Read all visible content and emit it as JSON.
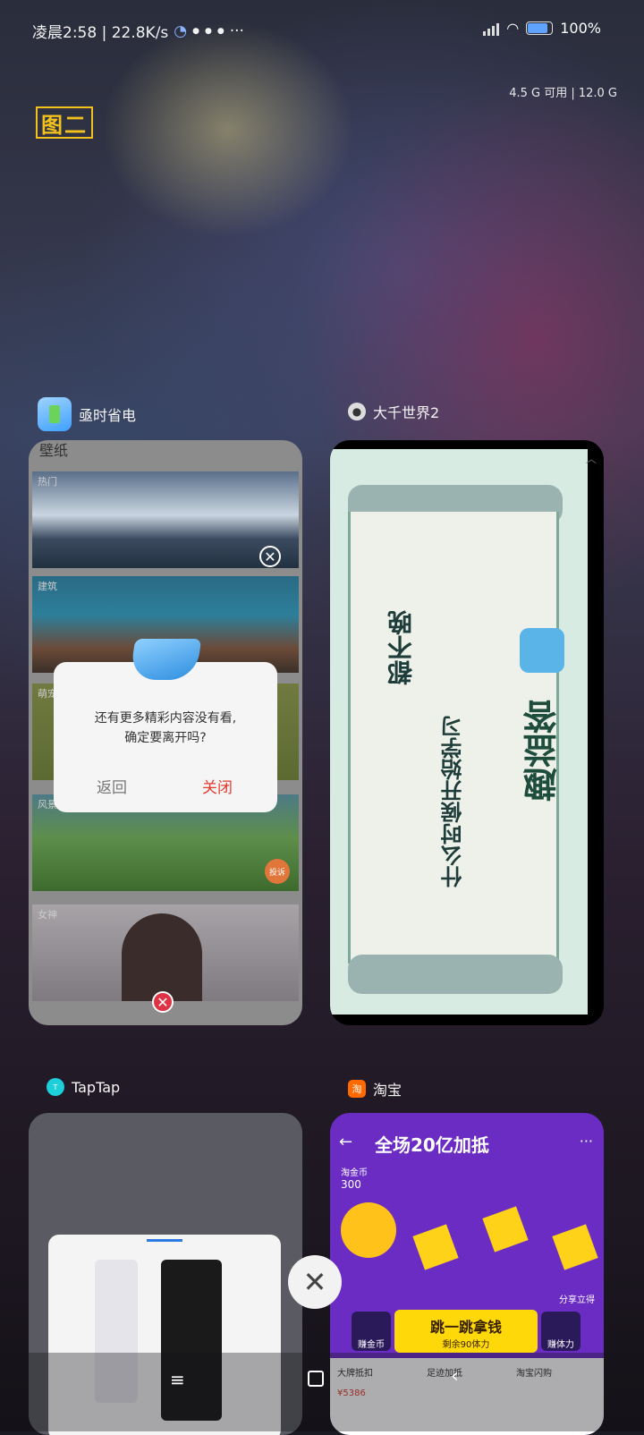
{
  "status": {
    "time_text": "凌晨2:58 | 22.8K/s",
    "battery": "100%",
    "memory": "4.5 G 可用 | 12.0 G"
  },
  "badge_text": "图二",
  "apps": [
    {
      "name": "亟时省电",
      "icon": "battery-saver-icon"
    },
    {
      "name": "大千世界2",
      "icon": "world-icon"
    },
    {
      "name": "TapTap",
      "icon": "taptap-icon"
    },
    {
      "name": "淘宝",
      "icon": "taobao-icon"
    }
  ],
  "card1": {
    "header": "壁纸",
    "tiles": [
      "热门",
      "建筑",
      "萌宠",
      "风景",
      "女神"
    ],
    "dialog_msg_line1": "还有更多精彩内容没有看,",
    "dialog_msg_line2": "确定要离开吗?",
    "dialog_back": "返回",
    "dialog_close": "关闭",
    "report": "投诉"
  },
  "card2": {
    "scroll_text1": "什么时候开始学习",
    "scroll_text2": "都不晚",
    "brand": "趣益答"
  },
  "card4": {
    "title": "全场20亿加抵",
    "cta": "跳一跳拿钱",
    "cta_sub": "剩余90体力",
    "item1": "赚金币",
    "item2": "赚体力",
    "share": "分享立得",
    "coin_label": "淘金币",
    "coin_value": "300",
    "bottom1": "大牌抵扣",
    "bottom2": "足迹加抵",
    "bottom3": "淘宝闪购",
    "price": "¥5386"
  },
  "colors": {
    "accent_red": "#e23b2e",
    "badge_yellow": "#f2c11c",
    "taobao_purple": "#6a2cc2"
  }
}
